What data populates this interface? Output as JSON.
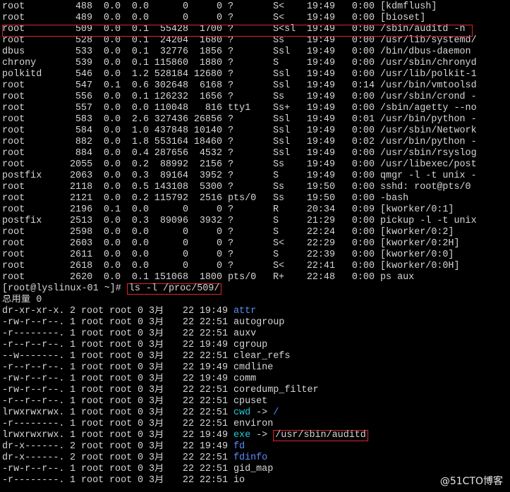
{
  "ps_rows": [
    {
      "user": "root",
      "pid": "488",
      "cpu": "0.0",
      "mem": "0.0",
      "vsz": "0",
      "rss": "0",
      "tty": "?",
      "stat": "S<",
      "start": "19:49",
      "time": "0:00",
      "command": "[kdmflush]"
    },
    {
      "user": "root",
      "pid": "489",
      "cpu": "0.0",
      "mem": "0.0",
      "vsz": "0",
      "rss": "0",
      "tty": "?",
      "stat": "S<",
      "start": "19:49",
      "time": "0:00",
      "command": "[bioset]"
    },
    {
      "user": "root",
      "pid": "509",
      "cpu": "0.0",
      "mem": "0.1",
      "vsz": "55428",
      "rss": "1700",
      "tty": "?",
      "stat": "S<sl",
      "start": "19:49",
      "time": "0:00",
      "command": "/sbin/auditd -n"
    },
    {
      "user": "root",
      "pid": "528",
      "cpu": "0.0",
      "mem": "0.1",
      "vsz": "24204",
      "rss": "1680",
      "tty": "?",
      "stat": "Ss",
      "start": "19:49",
      "time": "0:00",
      "command": "/usr/lib/systemd/"
    },
    {
      "user": "dbus",
      "pid": "533",
      "cpu": "0.0",
      "mem": "0.1",
      "vsz": "32776",
      "rss": "1856",
      "tty": "?",
      "stat": "Ssl",
      "start": "19:49",
      "time": "0:00",
      "command": "/bin/dbus-daemon"
    },
    {
      "user": "chrony",
      "pid": "539",
      "cpu": "0.0",
      "mem": "0.1",
      "vsz": "115860",
      "rss": "1880",
      "tty": "?",
      "stat": "S",
      "start": "19:49",
      "time": "0:00",
      "command": "/usr/sbin/chronyd"
    },
    {
      "user": "polkitd",
      "pid": "546",
      "cpu": "0.0",
      "mem": "1.2",
      "vsz": "528184",
      "rss": "12680",
      "tty": "?",
      "stat": "Ssl",
      "start": "19:49",
      "time": "0:00",
      "command": "/usr/lib/polkit-1"
    },
    {
      "user": "root",
      "pid": "547",
      "cpu": "0.1",
      "mem": "0.6",
      "vsz": "302648",
      "rss": "6168",
      "tty": "?",
      "stat": "Ssl",
      "start": "19:49",
      "time": "0:14",
      "command": "/usr/bin/vmtoolsd"
    },
    {
      "user": "root",
      "pid": "556",
      "cpu": "0.0",
      "mem": "0.1",
      "vsz": "126232",
      "rss": "1656",
      "tty": "?",
      "stat": "Ss",
      "start": "19:49",
      "time": "0:00",
      "command": "/usr/sbin/crond -"
    },
    {
      "user": "root",
      "pid": "557",
      "cpu": "0.0",
      "mem": "0.0",
      "vsz": "110048",
      "rss": "816",
      "tty": "tty1",
      "stat": "Ss+",
      "start": "19:49",
      "time": "0:00",
      "command": "/sbin/agetty --no"
    },
    {
      "user": "root",
      "pid": "583",
      "cpu": "0.0",
      "mem": "2.6",
      "vsz": "327436",
      "rss": "26856",
      "tty": "?",
      "stat": "Ssl",
      "start": "19:49",
      "time": "0:01",
      "command": "/usr/bin/python -"
    },
    {
      "user": "root",
      "pid": "584",
      "cpu": "0.0",
      "mem": "1.0",
      "vsz": "437848",
      "rss": "10140",
      "tty": "?",
      "stat": "Ssl",
      "start": "19:49",
      "time": "0:00",
      "command": "/usr/sbin/Network"
    },
    {
      "user": "root",
      "pid": "882",
      "cpu": "0.0",
      "mem": "1.8",
      "vsz": "553164",
      "rss": "18460",
      "tty": "?",
      "stat": "Ssl",
      "start": "19:49",
      "time": "0:02",
      "command": "/usr/bin/python -"
    },
    {
      "user": "root",
      "pid": "884",
      "cpu": "0.0",
      "mem": "0.4",
      "vsz": "287656",
      "rss": "4532",
      "tty": "?",
      "stat": "Ssl",
      "start": "19:49",
      "time": "0:00",
      "command": "/usr/sbin/rsyslog"
    },
    {
      "user": "root",
      "pid": "2055",
      "cpu": "0.0",
      "mem": "0.2",
      "vsz": "88992",
      "rss": "2156",
      "tty": "?",
      "stat": "Ss",
      "start": "19:49",
      "time": "0:00",
      "command": "/usr/libexec/post"
    },
    {
      "user": "postfix",
      "pid": "2063",
      "cpu": "0.0",
      "mem": "0.3",
      "vsz": "89164",
      "rss": "3952",
      "tty": "?",
      "stat": "S",
      "start": "19:49",
      "time": "0:00",
      "command": "qmgr -l -t unix -"
    },
    {
      "user": "root",
      "pid": "2118",
      "cpu": "0.0",
      "mem": "0.5",
      "vsz": "143108",
      "rss": "5300",
      "tty": "?",
      "stat": "Ss",
      "start": "19:50",
      "time": "0:00",
      "command": "sshd: root@pts/0"
    },
    {
      "user": "root",
      "pid": "2121",
      "cpu": "0.0",
      "mem": "0.2",
      "vsz": "115792",
      "rss": "2516",
      "tty": "pts/0",
      "stat": "Ss",
      "start": "19:50",
      "time": "0:00",
      "command": "-bash"
    },
    {
      "user": "root",
      "pid": "2196",
      "cpu": "0.1",
      "mem": "0.0",
      "vsz": "0",
      "rss": "0",
      "tty": "?",
      "stat": "R",
      "start": "20:34",
      "time": "0:09",
      "command": "[kworker/0:1]"
    },
    {
      "user": "postfix",
      "pid": "2513",
      "cpu": "0.0",
      "mem": "0.3",
      "vsz": "89096",
      "rss": "3932",
      "tty": "?",
      "stat": "S",
      "start": "21:29",
      "time": "0:00",
      "command": "pickup -l -t unix"
    },
    {
      "user": "root",
      "pid": "2598",
      "cpu": "0.0",
      "mem": "0.0",
      "vsz": "0",
      "rss": "0",
      "tty": "?",
      "stat": "S",
      "start": "22:24",
      "time": "0:00",
      "command": "[kworker/0:2]"
    },
    {
      "user": "root",
      "pid": "2603",
      "cpu": "0.0",
      "mem": "0.0",
      "vsz": "0",
      "rss": "0",
      "tty": "?",
      "stat": "S<",
      "start": "22:29",
      "time": "0:00",
      "command": "[kworker/0:2H]"
    },
    {
      "user": "root",
      "pid": "2611",
      "cpu": "0.0",
      "mem": "0.0",
      "vsz": "0",
      "rss": "0",
      "tty": "?",
      "stat": "S",
      "start": "22:39",
      "time": "0:00",
      "command": "[kworker/0:0]"
    },
    {
      "user": "root",
      "pid": "2618",
      "cpu": "0.0",
      "mem": "0.0",
      "vsz": "0",
      "rss": "0",
      "tty": "?",
      "stat": "S<",
      "start": "22:41",
      "time": "0:00",
      "command": "[kworker/0:0H]"
    },
    {
      "user": "root",
      "pid": "2620",
      "cpu": "0.0",
      "mem": "0.1",
      "vsz": "151068",
      "rss": "1800",
      "tty": "pts/0",
      "stat": "R+",
      "start": "22:48",
      "time": "0:00",
      "command": "ps aux"
    }
  ],
  "prompt": {
    "text": "[root@lyslinux-01 ~]# ",
    "command": "ls -l /proc/509/"
  },
  "total_line": "总用量 0",
  "ls_rows": [
    {
      "perm": "dr-xr-xr-x.",
      "links": "2",
      "owner": "root",
      "group": "root",
      "size": "0",
      "month": "3月",
      "day": "22",
      "time": "19:49",
      "name": "attr",
      "type": "dir",
      "target": ""
    },
    {
      "perm": "-rw-r--r--.",
      "links": "1",
      "owner": "root",
      "group": "root",
      "size": "0",
      "month": "3月",
      "day": "22",
      "time": "22:51",
      "name": "autogroup",
      "type": "file",
      "target": ""
    },
    {
      "perm": "-r--------.",
      "links": "1",
      "owner": "root",
      "group": "root",
      "size": "0",
      "month": "3月",
      "day": "22",
      "time": "22:51",
      "name": "auxv",
      "type": "file",
      "target": ""
    },
    {
      "perm": "-r--r--r--.",
      "links": "1",
      "owner": "root",
      "group": "root",
      "size": "0",
      "month": "3月",
      "day": "22",
      "time": "19:49",
      "name": "cgroup",
      "type": "file",
      "target": ""
    },
    {
      "perm": "--w-------.",
      "links": "1",
      "owner": "root",
      "group": "root",
      "size": "0",
      "month": "3月",
      "day": "22",
      "time": "22:51",
      "name": "clear_refs",
      "type": "file",
      "target": ""
    },
    {
      "perm": "-r--r--r--.",
      "links": "1",
      "owner": "root",
      "group": "root",
      "size": "0",
      "month": "3月",
      "day": "22",
      "time": "19:49",
      "name": "cmdline",
      "type": "file",
      "target": ""
    },
    {
      "perm": "-rw-r--r--.",
      "links": "1",
      "owner": "root",
      "group": "root",
      "size": "0",
      "month": "3月",
      "day": "22",
      "time": "19:49",
      "name": "comm",
      "type": "file",
      "target": ""
    },
    {
      "perm": "-rw-r--r--.",
      "links": "1",
      "owner": "root",
      "group": "root",
      "size": "0",
      "month": "3月",
      "day": "22",
      "time": "22:51",
      "name": "coredump_filter",
      "type": "file",
      "target": ""
    },
    {
      "perm": "-r--r--r--.",
      "links": "1",
      "owner": "root",
      "group": "root",
      "size": "0",
      "month": "3月",
      "day": "22",
      "time": "22:51",
      "name": "cpuset",
      "type": "file",
      "target": ""
    },
    {
      "perm": "lrwxrwxrwx.",
      "links": "1",
      "owner": "root",
      "group": "root",
      "size": "0",
      "month": "3月",
      "day": "22",
      "time": "22:51",
      "name": "cwd",
      "type": "link",
      "target": "/"
    },
    {
      "perm": "-r--------.",
      "links": "1",
      "owner": "root",
      "group": "root",
      "size": "0",
      "month": "3月",
      "day": "22",
      "time": "22:51",
      "name": "environ",
      "type": "file",
      "target": ""
    },
    {
      "perm": "lrwxrwxrwx.",
      "links": "1",
      "owner": "root",
      "group": "root",
      "size": "0",
      "month": "3月",
      "day": "22",
      "time": "19:49",
      "name": "exe",
      "type": "link",
      "target": "/usr/sbin/auditd"
    },
    {
      "perm": "dr-x------.",
      "links": "2",
      "owner": "root",
      "group": "root",
      "size": "0",
      "month": "3月",
      "day": "22",
      "time": "19:49",
      "name": "fd",
      "type": "dir",
      "target": ""
    },
    {
      "perm": "dr-x------.",
      "links": "2",
      "owner": "root",
      "group": "root",
      "size": "0",
      "month": "3月",
      "day": "22",
      "time": "22:51",
      "name": "fdinfo",
      "type": "dir",
      "target": ""
    },
    {
      "perm": "-rw-r--r--.",
      "links": "1",
      "owner": "root",
      "group": "root",
      "size": "0",
      "month": "3月",
      "day": "22",
      "time": "22:51",
      "name": "gid_map",
      "type": "file",
      "target": ""
    },
    {
      "perm": "-r--------.",
      "links": "1",
      "owner": "root",
      "group": "root",
      "size": "0",
      "month": "3月",
      "day": "22",
      "time": "22:51",
      "name": "io",
      "type": "file",
      "target": ""
    }
  ],
  "watermark": "@51CTO博客",
  "colors": {
    "background": "#000000",
    "foreground": "#d6d6d6",
    "directory": "#5b8cff",
    "symlink": "#25c6d8",
    "highlight_box": "#e0242c"
  }
}
